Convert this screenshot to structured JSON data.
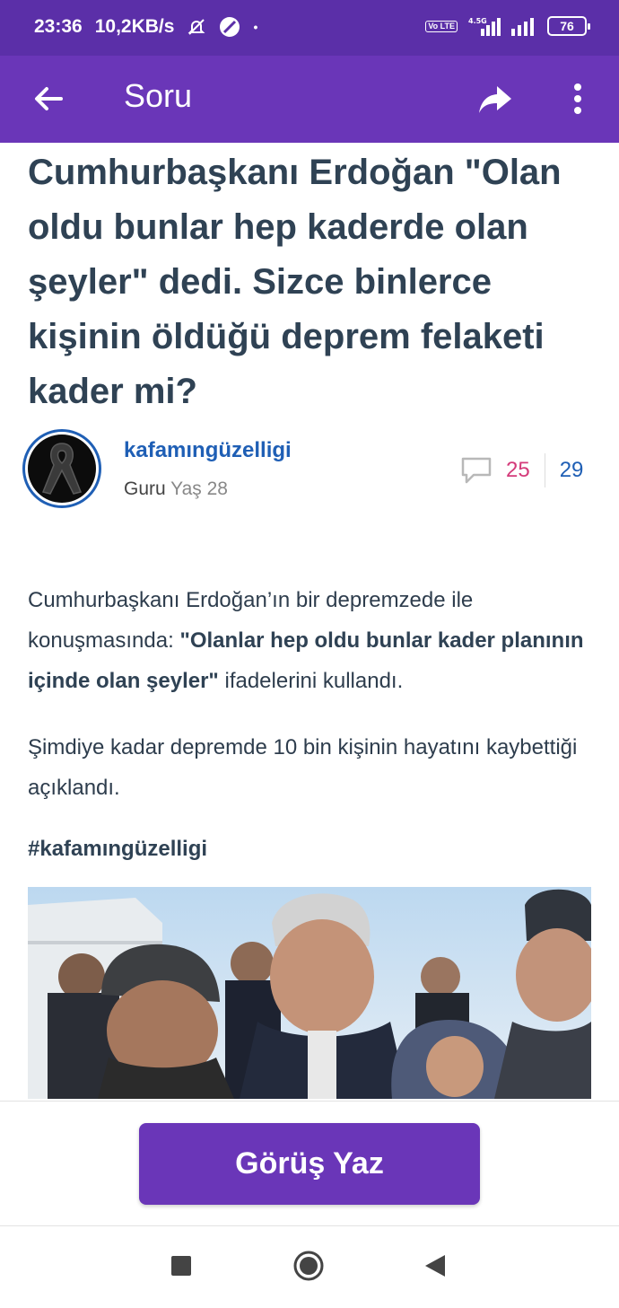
{
  "status_bar": {
    "time": "23:36",
    "speed": "10,2KB/s",
    "network": "4.5G",
    "volte": "Vo LTE",
    "battery": "76"
  },
  "app_bar": {
    "title": "Soru"
  },
  "question": {
    "title": "Cumhurbaşkanı Erdoğan \"Olan oldu bunlar hep kaderde olan şeyler\" dedi. Sizce binlerce kişinin öldüğü deprem felaketi kader mi?"
  },
  "author": {
    "username": "kafamıngüzelligi",
    "rank": "Guru",
    "age": "Yaş 28"
  },
  "stats": {
    "opinions": "25",
    "followers": "29"
  },
  "body": {
    "p1_start": "Cumhurbaşkanı Erdoğan’ın bir depremzede ile konuşmasında: ",
    "p1_bold": "\"Olanlar hep oldu bunlar kader planının içinde olan şeyler\"",
    "p1_end": " ifadelerini kullandı.",
    "p2": "Şimdiye kadar depremde 10 bin kişinin hayatını kaybettiği açıklandı.",
    "hashtag": "#kafamıngüzelligi"
  },
  "actions": {
    "write_opinion": "Görüş Yaz"
  },
  "colors": {
    "primary": "#6a36b8",
    "status_bar": "#5b2fa8",
    "link_blue": "#1f5fb5",
    "pink_count": "#d43b7a",
    "heading": "#2f4254"
  }
}
